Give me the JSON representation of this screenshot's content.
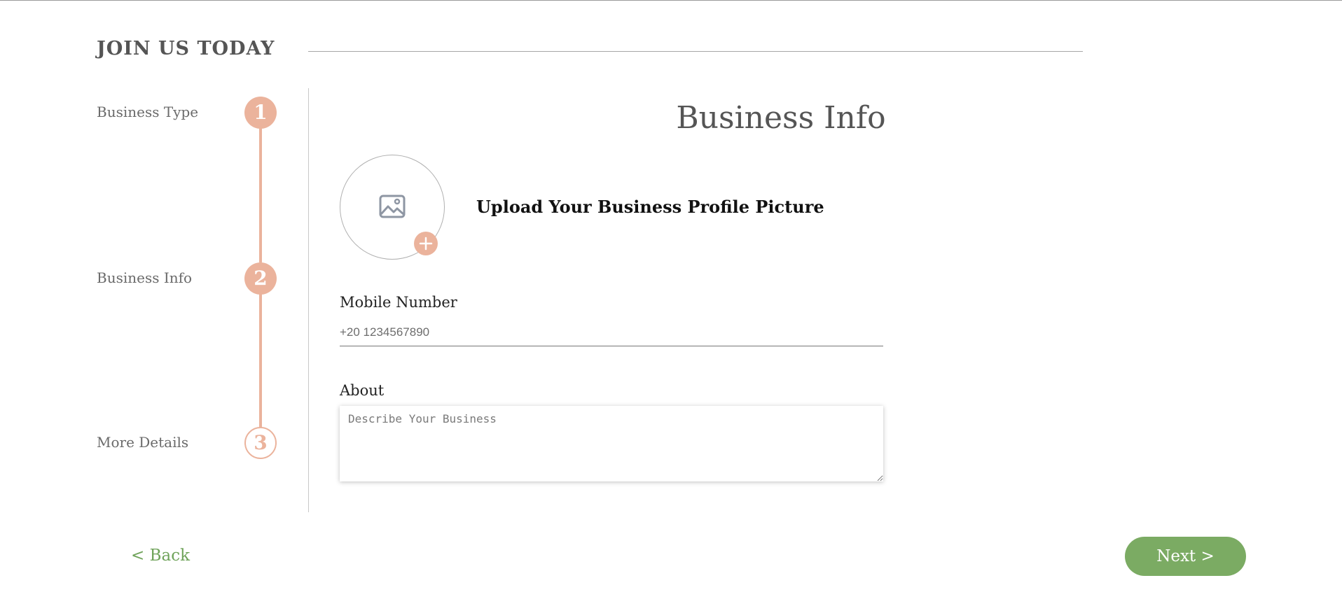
{
  "header": {
    "title": "JOIN US TODAY"
  },
  "stepper": {
    "steps": [
      {
        "label": "Business Type",
        "number": "1",
        "state": "completed"
      },
      {
        "label": "Business Info",
        "number": "2",
        "state": "active"
      },
      {
        "label": "More Details",
        "number": "3",
        "state": "upcoming"
      }
    ]
  },
  "main": {
    "title": "Business Info",
    "upload": {
      "label": "Upload Your Business Profile Picture",
      "placeholder_icon": "image-icon",
      "add_icon": "plus-icon"
    },
    "mobile": {
      "label": "Mobile Number",
      "placeholder": "+20 1234567890"
    },
    "about": {
      "label": "About",
      "placeholder": "Describe Your Business"
    }
  },
  "footer": {
    "back_label": "< Back",
    "next_label": "Next >"
  },
  "colors": {
    "accent_step": "#ebb39c",
    "primary_button": "#7bab63",
    "back_link": "#6fa35a",
    "heading_text": "#555555"
  }
}
